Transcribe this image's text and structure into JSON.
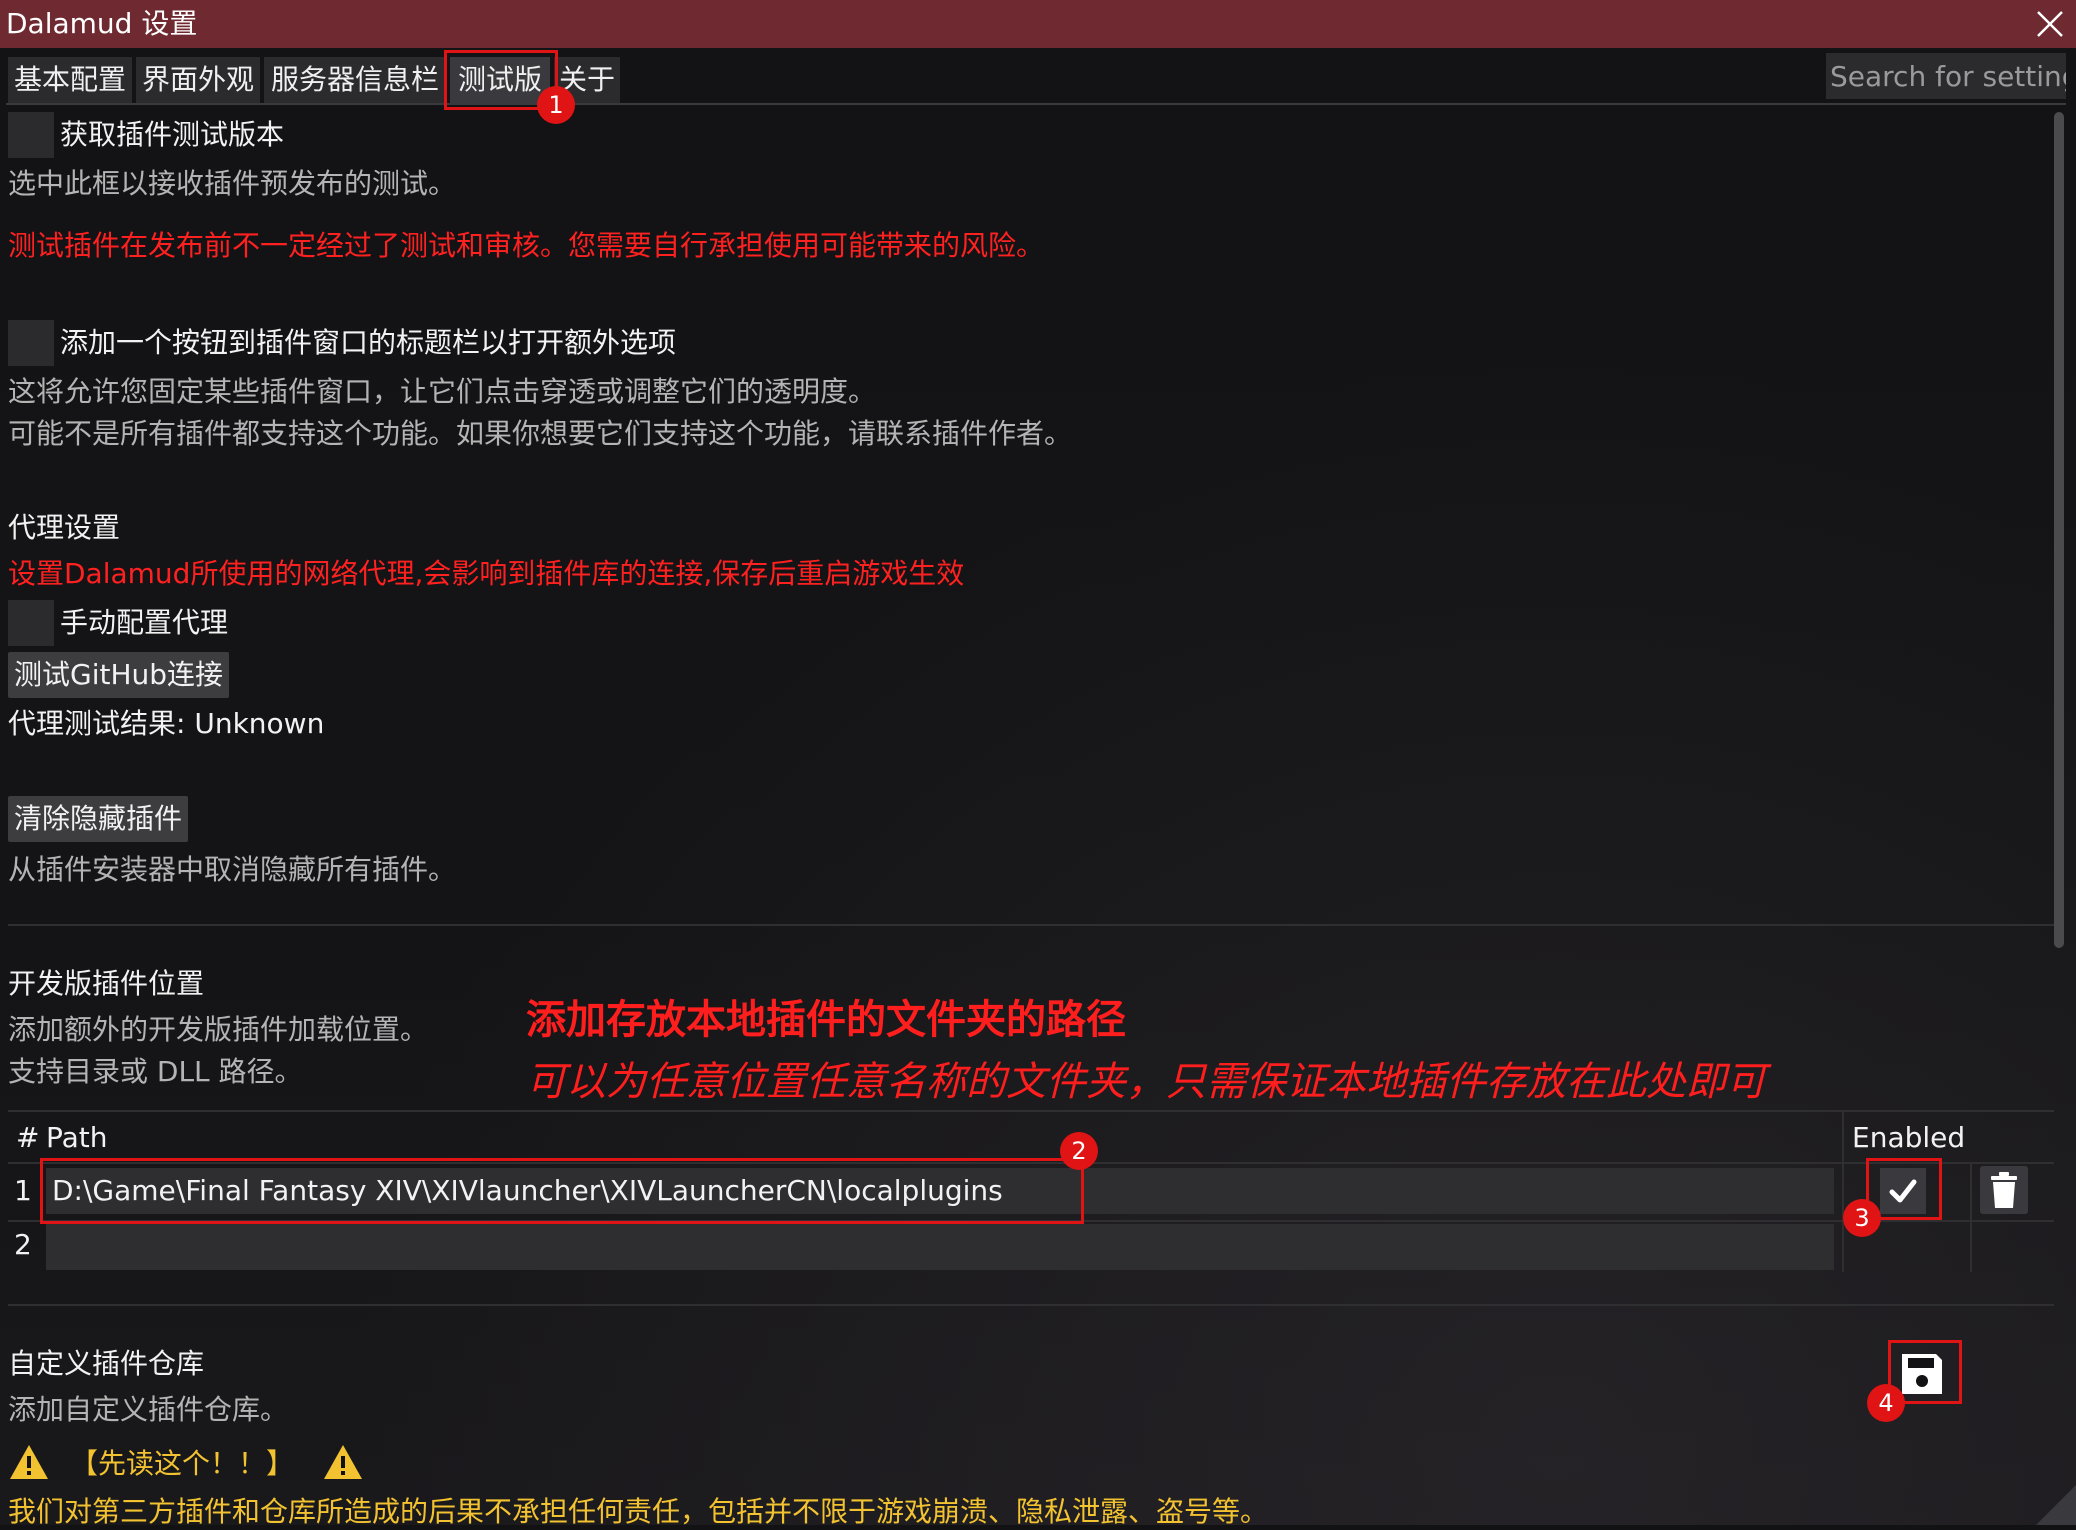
{
  "window": {
    "title": "Dalamud 设置"
  },
  "tabs": [
    {
      "label": "基本配置"
    },
    {
      "label": "界面外观"
    },
    {
      "label": "服务器信息栏"
    },
    {
      "label": "测试版"
    },
    {
      "label": "关于"
    }
  ],
  "search": {
    "placeholder": "Search for settings"
  },
  "testing": {
    "opt_in_label": "获取插件测试版本",
    "opt_in_desc": "选中此框以接收插件预发布的测试。",
    "warning": "测试插件在发布前不一定经过了测试和审核。您需要自行承担使用可能带来的风险。",
    "titlebar_label": "添加一个按钮到插件窗口的标题栏以打开额外选项",
    "titlebar_desc1": "这将允许您固定某些插件窗口，让它们点击穿透或调整它们的透明度。",
    "titlebar_desc2": "可能不是所有插件都支持这个功能。如果你想要它们支持这个功能，请联系插件作者。"
  },
  "proxy": {
    "heading": "代理设置",
    "note": "设置Dalamud所使用的网络代理,会影响到插件库的连接,保存后重启游戏生效",
    "manual_label": "手动配置代理",
    "test_button": "测试GitHub连接",
    "result": "代理测试结果: Unknown"
  },
  "hidden": {
    "clear_button": "清除隐藏插件",
    "desc": "从插件安装器中取消隐藏所有插件。"
  },
  "devplugins": {
    "heading": "开发版插件位置",
    "desc1": "添加额外的开发版插件加载位置。",
    "desc2": "支持目录或 DLL 路径。",
    "annotation_title": "添加存放本地插件的文件夹的路径",
    "annotation_sub": "可以为任意位置任意名称的文件夹，只需保证本地插件存放在此处即可",
    "col_num": "#",
    "col_path": "Path",
    "col_enabled": "Enabled",
    "rows": [
      {
        "num": "1",
        "path": "D:\\Game\\Final Fantasy XIV\\XIVlauncher\\XIVLauncherCN\\localplugins",
        "enabled": true
      },
      {
        "num": "2",
        "path": ""
      }
    ]
  },
  "repos": {
    "heading": "自定义插件仓库",
    "desc": "添加自定义插件仓库。",
    "read_first": "【先读这个！！】",
    "disclaimer": "我们对第三方插件和仓库所造成的后果不承担任何责任，包括并不限于游戏崩溃、隐私泄露、盗号等。"
  },
  "badges": [
    "1",
    "2",
    "3",
    "4"
  ],
  "icons": [
    "close-icon",
    "checkmark-icon",
    "trash-icon",
    "save-icon",
    "warning-icon"
  ],
  "colors": {
    "titlebar": "#6e2a30",
    "warning_red": "#ff2020",
    "warning_yellow": "#f2c230",
    "annotation_red": "#e01414"
  }
}
